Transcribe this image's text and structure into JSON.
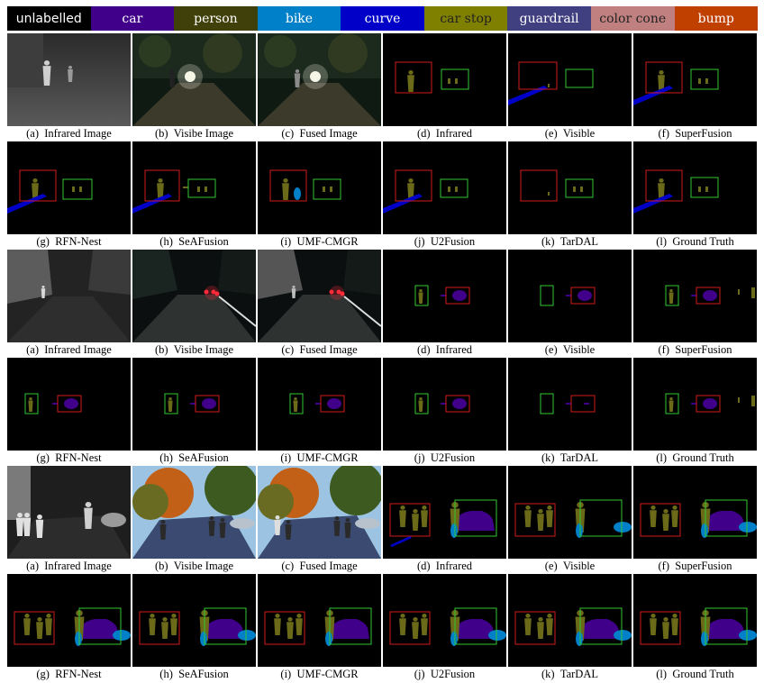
{
  "legend": [
    {
      "label": "unlabelled",
      "color": "#000000"
    },
    {
      "label": "car",
      "color": "#40008a"
    },
    {
      "label": "person",
      "color": "#40400a"
    },
    {
      "label": "bike",
      "color": "#0080c8"
    },
    {
      "label": "curve",
      "color": "#0000c8"
    },
    {
      "label": "car stop",
      "color": "#808000"
    },
    {
      "label": "guardrail",
      "color": "#404080"
    },
    {
      "label": "color cone",
      "color": "#c08080"
    },
    {
      "label": "bump",
      "color": "#c04000"
    }
  ],
  "groups": [
    {
      "row1": [
        {
          "label": "(a)",
          "name": "Infrared Image",
          "kind": "ir",
          "scene": "street-night"
        },
        {
          "label": "(b)",
          "name": "Visibe Image",
          "kind": "vis",
          "scene": "street-night"
        },
        {
          "label": "(c)",
          "name": "Fused Image",
          "kind": "fused",
          "scene": "street-night"
        },
        {
          "label": "(d)",
          "name": "Infrared",
          "kind": "seg",
          "scene": "s1"
        },
        {
          "label": "(e)",
          "name": "Visible",
          "kind": "seg",
          "scene": "s1"
        },
        {
          "label": "(f)",
          "name": "SuperFusion",
          "kind": "seg",
          "scene": "s1"
        }
      ],
      "row2": [
        {
          "label": "(g)",
          "name": "RFN-Nest",
          "kind": "seg",
          "scene": "s1"
        },
        {
          "label": "(h)",
          "name": "SeAFusion",
          "kind": "seg",
          "scene": "s1"
        },
        {
          "label": "(i)",
          "name": "UMF-CMGR",
          "kind": "seg",
          "scene": "s1"
        },
        {
          "label": "(j)",
          "name": "U2Fusion",
          "kind": "seg",
          "scene": "s1"
        },
        {
          "label": "(k)",
          "name": "TarDAL",
          "kind": "seg",
          "scene": "s1"
        },
        {
          "label": "(l)",
          "name": "Ground Truth",
          "kind": "seg",
          "scene": "s1"
        }
      ]
    },
    {
      "row1": [
        {
          "label": "(a)",
          "name": "Infrared Image",
          "kind": "ir",
          "scene": "road-night"
        },
        {
          "label": "(b)",
          "name": "Visibe Image",
          "kind": "vis",
          "scene": "road-night"
        },
        {
          "label": "(c)",
          "name": "Fused Image",
          "kind": "fused",
          "scene": "road-night"
        },
        {
          "label": "(d)",
          "name": "Infrared",
          "kind": "seg",
          "scene": "s2"
        },
        {
          "label": "(e)",
          "name": "Visible",
          "kind": "seg",
          "scene": "s2"
        },
        {
          "label": "(f)",
          "name": "SuperFusion",
          "kind": "seg",
          "scene": "s2"
        }
      ],
      "row2": [
        {
          "label": "(g)",
          "name": "RFN-Nest",
          "kind": "seg",
          "scene": "s2"
        },
        {
          "label": "(h)",
          "name": "SeAFusion",
          "kind": "seg",
          "scene": "s2"
        },
        {
          "label": "(i)",
          "name": "UMF-CMGR",
          "kind": "seg",
          "scene": "s2"
        },
        {
          "label": "(j)",
          "name": "U2Fusion",
          "kind": "seg",
          "scene": "s2"
        },
        {
          "label": "(k)",
          "name": "TarDAL",
          "kind": "seg",
          "scene": "s2"
        },
        {
          "label": "(l)",
          "name": "Ground Truth",
          "kind": "seg",
          "scene": "s2"
        }
      ]
    },
    {
      "row1": [
        {
          "label": "(a)",
          "name": "Infrared Image",
          "kind": "ir",
          "scene": "park-day"
        },
        {
          "label": "(b)",
          "name": "Visibe Image",
          "kind": "vis",
          "scene": "park-day"
        },
        {
          "label": "(c)",
          "name": "Fused Image",
          "kind": "fused",
          "scene": "park-day"
        },
        {
          "label": "(d)",
          "name": "Infrared",
          "kind": "seg",
          "scene": "s3"
        },
        {
          "label": "(e)",
          "name": "Visible",
          "kind": "seg",
          "scene": "s3"
        },
        {
          "label": "(f)",
          "name": "SuperFusion",
          "kind": "seg",
          "scene": "s3"
        }
      ],
      "row2": [
        {
          "label": "(g)",
          "name": "RFN-Nest",
          "kind": "seg",
          "scene": "s3"
        },
        {
          "label": "(h)",
          "name": "SeAFusion",
          "kind": "seg",
          "scene": "s3"
        },
        {
          "label": "(i)",
          "name": "UMF-CMGR",
          "kind": "seg",
          "scene": "s3"
        },
        {
          "label": "(j)",
          "name": "U2Fusion",
          "kind": "seg",
          "scene": "s3"
        },
        {
          "label": "(k)",
          "name": "TarDAL",
          "kind": "seg",
          "scene": "s3"
        },
        {
          "label": "(l)",
          "name": "Ground Truth",
          "kind": "seg",
          "scene": "s3"
        }
      ]
    }
  ]
}
